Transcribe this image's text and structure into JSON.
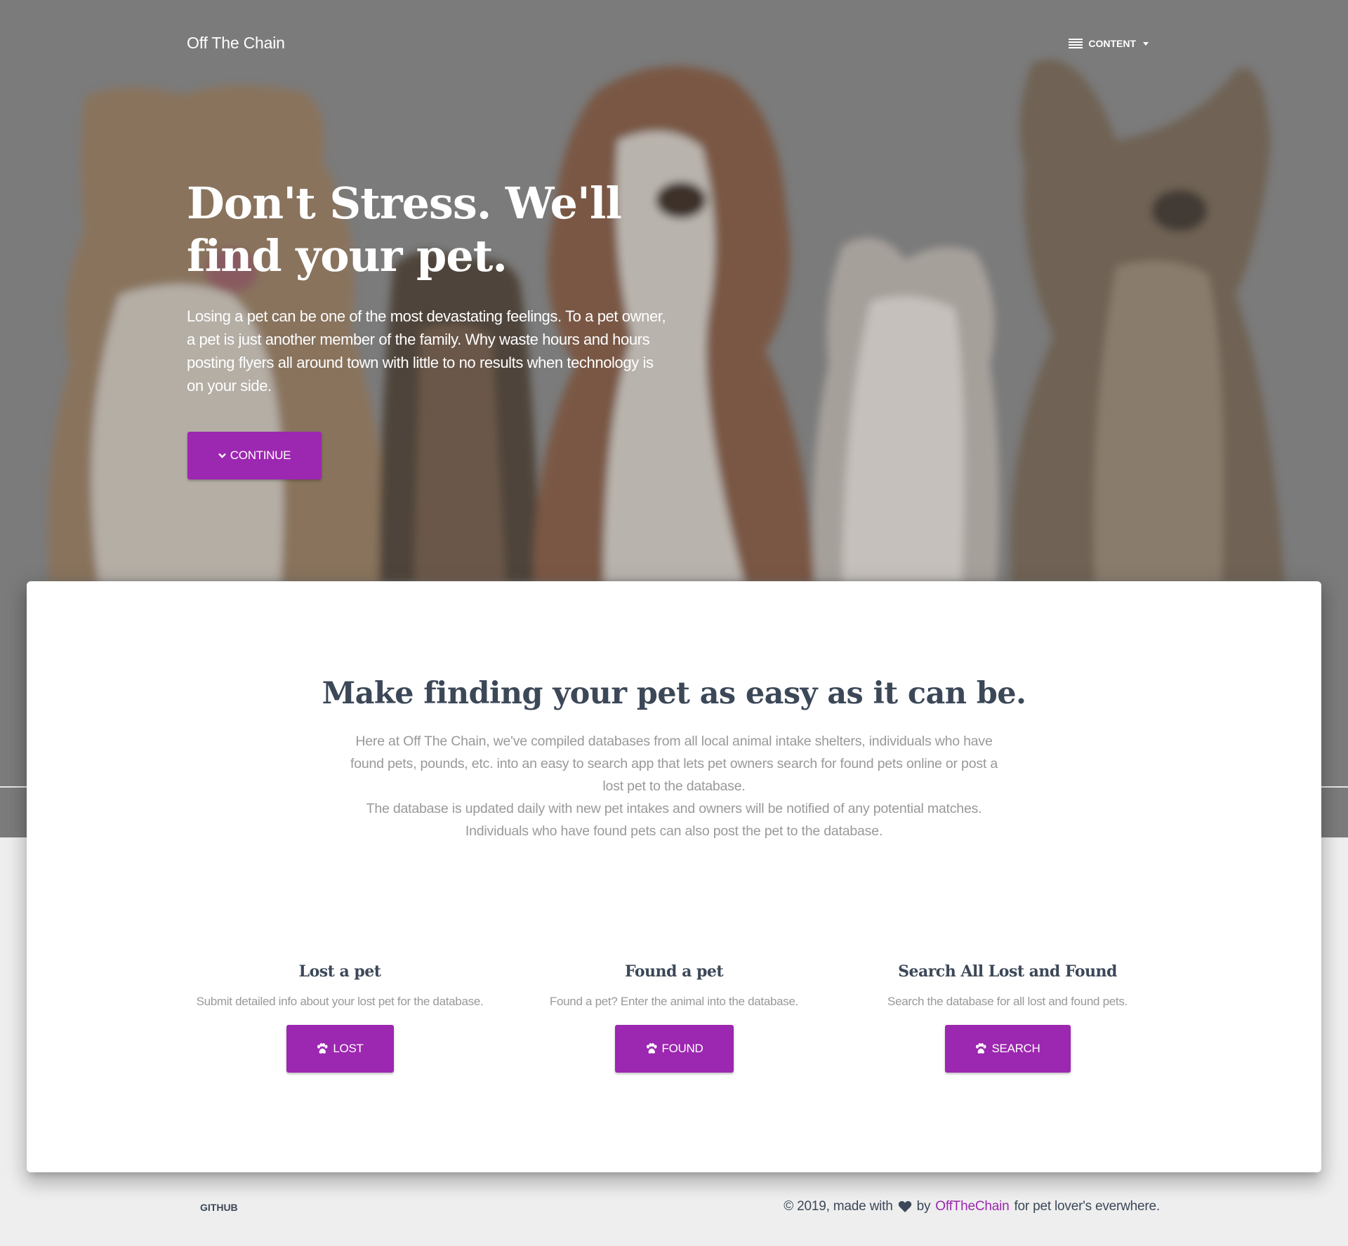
{
  "nav": {
    "brand": "Off The Chain",
    "menu_label": "CONTENT"
  },
  "hero": {
    "title": "Don't Stress. We'll find your pet.",
    "lead": "Losing a pet can be one of the most devastating feelings. To a pet owner, a pet is just another member of the family. Why waste hours and hours posting flyers all around town with little to no results when technology is on your side.",
    "continue_label": "CONTINUE"
  },
  "about": {
    "title": "Make finding your pet as easy as it can be.",
    "paragraph_1": "Here at Off The Chain, we've compiled databases from all local animal intake shelters, individuals who have found pets, pounds, etc. into an easy to search app that lets pet owners search for found pets online or post a lost pet to the database.",
    "paragraph_2": "The database is updated daily with new pet intakes and owners will be notified of any potential matches. Individuals who have found pets can also post the pet to the database."
  },
  "features": [
    {
      "title": "Lost a pet",
      "description": "Submit detailed info about your lost pet for the database.",
      "button_label": "LOST"
    },
    {
      "title": "Found a pet",
      "description": "Found a pet? Enter the animal into the database.",
      "button_label": "FOUND"
    },
    {
      "title": "Search All Lost and Found",
      "description": "Search the database for all lost and found pets.",
      "button_label": "SEARCH"
    }
  ],
  "footer": {
    "github_label": "GITHUB",
    "copyright_prefix": "© 2019, made with",
    "by": "by",
    "author": "OffTheChain",
    "suffix": "for pet lover's everwhere."
  },
  "colors": {
    "accent": "#9c27b0",
    "hero_overlay": "#7b7b7b",
    "heading": "#3c4858",
    "muted_text": "#999999",
    "page_background": "#eeeeee"
  },
  "icons": {
    "menu": "list-icon",
    "menu_caret": "caret-down-icon",
    "continue": "chevron-down-icon",
    "feature_buttons": "paw-icon",
    "footer_heart": "heart-icon"
  }
}
